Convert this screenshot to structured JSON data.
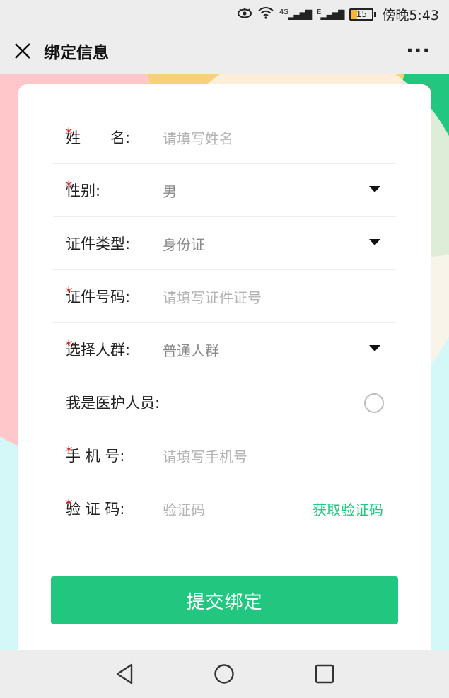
{
  "status_bar": {
    "network_left": "4G",
    "network_right": "E",
    "battery_level": "15",
    "time": "傍晚5:43"
  },
  "nav": {
    "title": "绑定信息",
    "more": "···"
  },
  "form": {
    "name": {
      "label": "姓　　名:",
      "placeholder": "请填写姓名",
      "required": "*"
    },
    "gender": {
      "label": "性别:",
      "value": "男",
      "required": "*"
    },
    "id_type": {
      "label": "证件类型:",
      "value": "身份证"
    },
    "id_number": {
      "label": "证件号码:",
      "placeholder": "请填写证件证号",
      "required": "*"
    },
    "group": {
      "label": "选择人群:",
      "value": "普通人群",
      "required": "*"
    },
    "medical_staff": {
      "label": "我是医护人员:"
    },
    "phone": {
      "label": "手 机 号:",
      "placeholder": "请填写手机号",
      "required": "*"
    },
    "code": {
      "label": "验 证 码:",
      "placeholder": "验证码",
      "required": "*",
      "get_code": "获取验证码"
    }
  },
  "submit_label": "提交绑定",
  "colors": {
    "accent": "#21c77f",
    "required": "#e02020",
    "background": "#d4f7f8",
    "pink": "#ffc7c9",
    "yellow": "#f9d07a"
  }
}
